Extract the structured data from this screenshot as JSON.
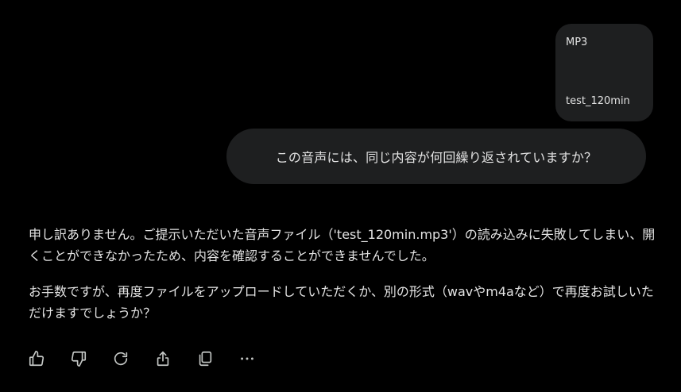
{
  "attachment": {
    "type": "MP3",
    "name": "test_120min"
  },
  "user_message": {
    "text": "この音声には、同じ内容が何回繰り返されていますか？"
  },
  "response": {
    "paragraphs": [
      "申し訳ありません。ご提示いただいた音声ファイル（'test_120min.mp3'）の読み込みに失敗してしまい、開くことができなかったため、内容を確認することができませんでした。",
      "お手数ですが、再度ファイルをアップロードしていただくか、別の形式（wavやm4aなど）で再度お試しいただけますでしょうか？"
    ]
  },
  "actions": {
    "icons": [
      "thumbs-up-icon",
      "thumbs-down-icon",
      "regenerate-icon",
      "share-icon",
      "copy-icon",
      "more-icon"
    ]
  },
  "colors": {
    "background": "#000000",
    "bubble": "#1e1f20",
    "text": "#e3e3e3",
    "icon": "#c4c7c5"
  }
}
